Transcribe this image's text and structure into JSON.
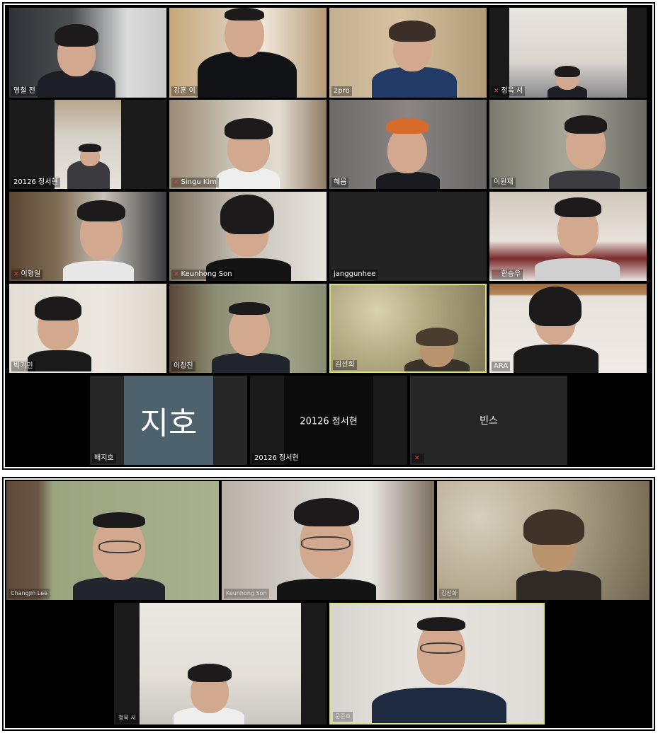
{
  "top_gallery": {
    "row1": [
      {
        "name": "영철 전",
        "muted": false
      },
      {
        "name": "강훈 이",
        "muted": false
      },
      {
        "name": "2pro",
        "muted": false
      },
      {
        "name": "정욱 서",
        "muted": true
      }
    ],
    "row2": [
      {
        "name": "20126 정서현",
        "muted": false
      },
      {
        "name": "Singu Kim",
        "muted": true
      },
      {
        "name": "혜음",
        "muted": false
      },
      {
        "name": "이원재",
        "muted": false
      }
    ],
    "row3": [
      {
        "name": "이형일",
        "muted": true
      },
      {
        "name": "Keunhong Son",
        "muted": true
      },
      {
        "name": "janggunhee",
        "muted": false
      },
      {
        "name": "한승우",
        "muted": true
      }
    ],
    "row4": [
      {
        "name": "박기민",
        "muted": false
      },
      {
        "name": "이창진",
        "muted": false
      },
      {
        "name": "김선희",
        "muted": false,
        "active_speaker": true
      },
      {
        "name": "ARA",
        "muted": false
      }
    ],
    "row5": [
      {
        "name": "배지호",
        "avatar_text": "지호"
      },
      {
        "name": "20126 정서현",
        "center_text": "20126 정서현"
      },
      {
        "name": "",
        "center_text": "빈스",
        "muted": true
      }
    ]
  },
  "bottom_gallery": {
    "row1": [
      {
        "name": "Changjin Lee"
      },
      {
        "name": "Keunhong Son"
      },
      {
        "name": "김선희"
      }
    ],
    "row2": [
      {
        "name": "정욱 서"
      },
      {
        "name": "문준호",
        "active_speaker": true
      }
    ]
  },
  "colors": {
    "active_border": "#d6e27a",
    "muted_icon": "#e0443a",
    "avatar_bg": "#4d626d"
  },
  "icons": {
    "muted": "mic-muted-icon"
  }
}
